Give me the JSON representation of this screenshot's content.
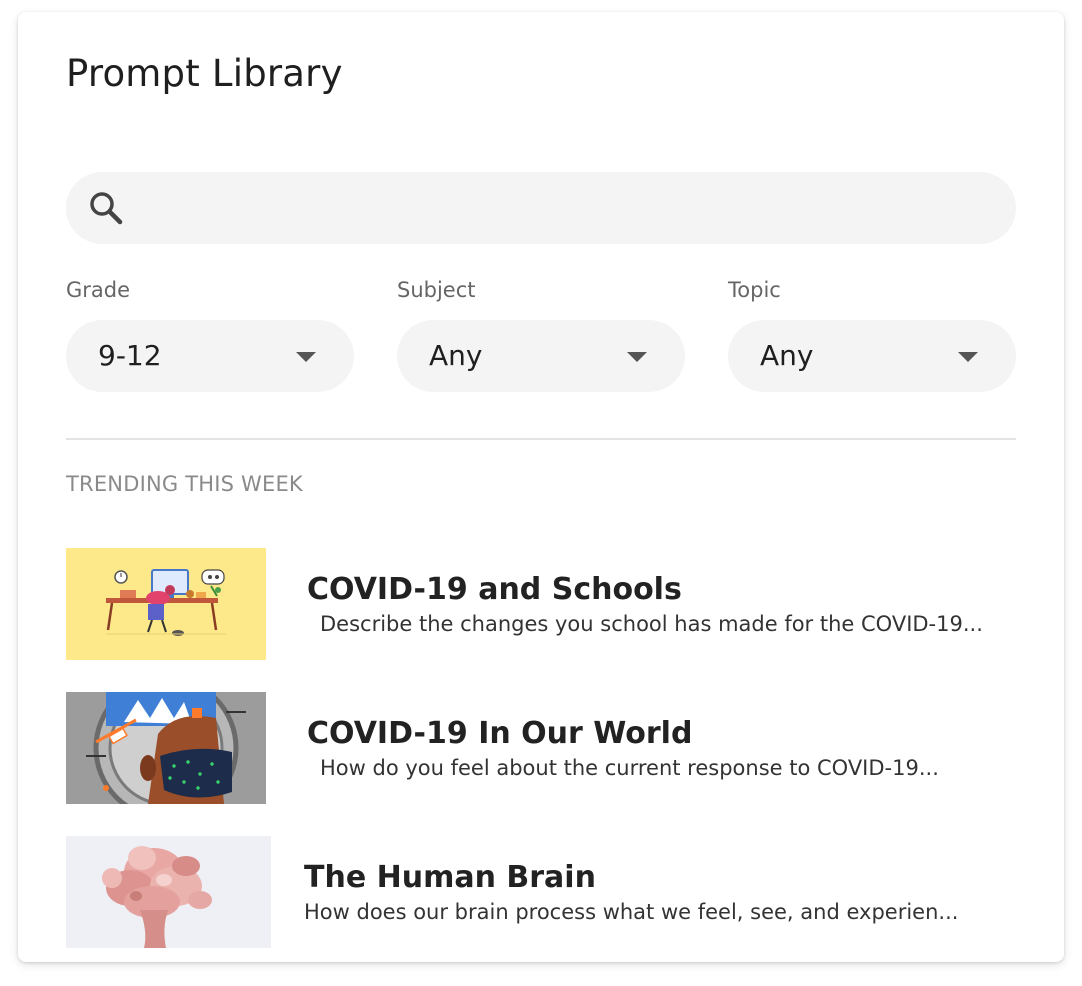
{
  "page": {
    "title": "Prompt Library"
  },
  "search": {
    "placeholder": "",
    "value": "",
    "icon": "search-icon"
  },
  "filters": [
    {
      "label": "Grade",
      "value": "9-12"
    },
    {
      "label": "Subject",
      "value": "Any"
    },
    {
      "label": "Topic",
      "value": "Any"
    }
  ],
  "trending": {
    "heading": "TRENDING THIS WEEK",
    "items": [
      {
        "title": "COVID-19 and Schools",
        "description": "Describe the changes you school has made for the COVID-19..."
      },
      {
        "title": "COVID-19 In Our World",
        "description": "How do you feel about the current response to COVID-19..."
      },
      {
        "title": "The Human Brain",
        "description": "How does our brain process what we feel, see, and experien..."
      }
    ]
  },
  "colors": {
    "card_background": "#ffffff",
    "input_background": "#f4f4f4",
    "heading_gray": "#8a8a8a",
    "thumb_yellow": "#fde98a",
    "thumb_mask_blue": "#1c2c4a",
    "thumb_brain_pink": "#e8a7a3"
  }
}
